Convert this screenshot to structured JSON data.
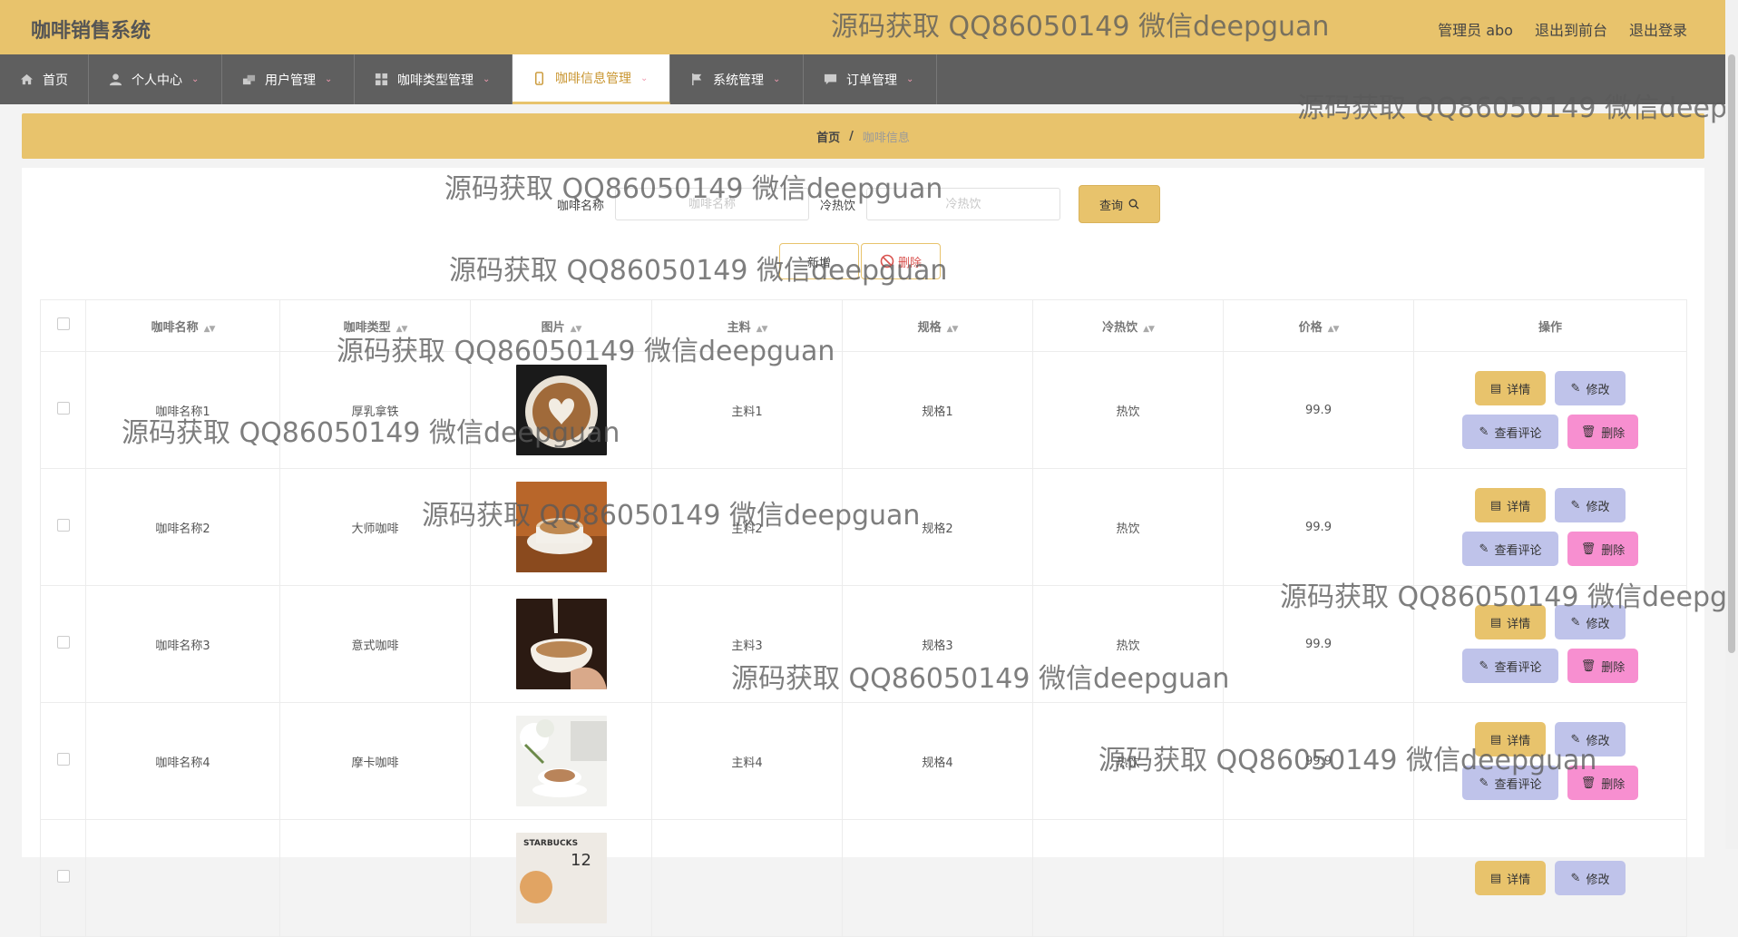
{
  "app": {
    "title": "咖啡销售系统"
  },
  "top_links": [
    "管理员 abo",
    "退出到前台",
    "退出登录"
  ],
  "nav": [
    {
      "label": "首页",
      "icon": "home-icon",
      "has_menu": false
    },
    {
      "label": "个人中心",
      "icon": "user-icon",
      "has_menu": true
    },
    {
      "label": "用户管理",
      "icon": "users-icon",
      "has_menu": true
    },
    {
      "label": "咖啡类型管理",
      "icon": "grid-icon",
      "has_menu": true
    },
    {
      "label": "咖啡信息管理",
      "icon": "phone-icon",
      "has_menu": true,
      "active": true
    },
    {
      "label": "系统管理",
      "icon": "flag-icon",
      "has_menu": true
    },
    {
      "label": "订单管理",
      "icon": "chat-icon",
      "has_menu": true
    }
  ],
  "breadcrumb": {
    "home": "首页",
    "sep": "/",
    "current": "咖啡信息"
  },
  "search": {
    "name_label": "咖啡名称",
    "name_placeholder": "咖啡名称",
    "temp_label": "冷热饮",
    "temp_placeholder": "冷热饮",
    "query_label": "查询"
  },
  "actions": {
    "add_label": "新增",
    "delete_label": "删除"
  },
  "table": {
    "headers": [
      "咖啡名称",
      "咖啡类型",
      "图片",
      "主料",
      "规格",
      "冷热饮",
      "价格",
      "操作"
    ],
    "rows": [
      {
        "name": "咖啡名称1",
        "type": "厚乳拿铁",
        "image": "latte-art-photo",
        "main": "主料1",
        "spec": "规格1",
        "temp": "热饮",
        "price": "99.9"
      },
      {
        "name": "咖啡名称2",
        "type": "大师咖啡",
        "image": "cappuccino-photo",
        "main": "主料2",
        "spec": "规格2",
        "temp": "热饮",
        "price": "99.9"
      },
      {
        "name": "咖啡名称3",
        "type": "意式咖啡",
        "image": "pour-milk-photo",
        "main": "主料3",
        "spec": "规格3",
        "temp": "热饮",
        "price": "99.9"
      },
      {
        "name": "咖啡名称4",
        "type": "摩卡咖啡",
        "image": "coffee-desk-photo",
        "main": "主料4",
        "spec": "规格4",
        "temp": "热饮",
        "price": "99.9"
      }
    ],
    "partial_row": {
      "image": "starbucks-photo",
      "image_text": [
        "STARBUCKS",
        "12"
      ]
    },
    "ops": {
      "detail": "详情",
      "edit": "修改",
      "review": "查看评论",
      "remove": "删除"
    }
  },
  "watermark": "源码获取 QQ86050149 微信deepguan",
  "colors": {
    "accent": "#e8c36c",
    "nav_bg": "#5f5f5f",
    "lavender": "#bfc3ea",
    "pink": "#f78fd0"
  }
}
